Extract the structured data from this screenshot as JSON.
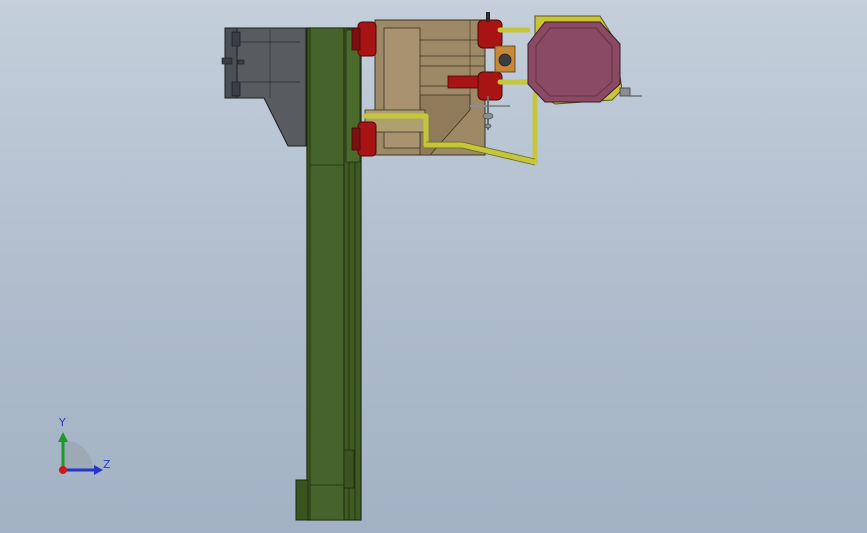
{
  "viewport": {
    "view_name": "",
    "background_top": "#c4cfdb",
    "background_bottom": "#a2b2c4"
  },
  "triad": {
    "y_label": "Y",
    "z_label": "Z",
    "y_color": "#1c9a2a",
    "z_color": "#2435c8",
    "x_color": "#c81c1c"
  },
  "colors": {
    "column": "#3f5b23",
    "column_edge": "#1f2b10",
    "bracket": "#585c60",
    "carriage": "#9e8966",
    "bearing": "#a81414",
    "pipe": "#c6c63a",
    "drum": "#8a4a64",
    "drum_frame": "#c8c43c",
    "tool": "#8a8e94"
  }
}
